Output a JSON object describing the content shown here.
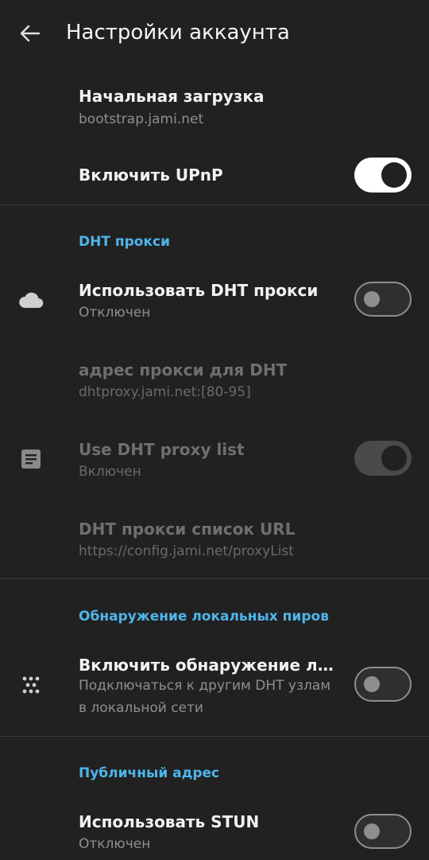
{
  "appbar": {
    "title": "Настройки аккаунта",
    "back_icon": "arrow-back-icon"
  },
  "rows": {
    "bootstrap": {
      "title": "Начальная загрузка",
      "summary": "bootstrap.jami.net"
    },
    "upnp": {
      "title": "Включить UPnP",
      "switch_on": true
    },
    "dht_proxy": {
      "title": "Использовать DHT прокси",
      "summary": "Отключен",
      "icon": "cloud-icon",
      "switch_on": false
    },
    "dht_proxy_address": {
      "title": "адрес прокси для DHT",
      "summary": "dhtproxy.jami.net:[80-95]",
      "enabled": false
    },
    "dht_proxy_list": {
      "title": "Use DHT proxy list",
      "summary": "Включен",
      "icon": "document-icon",
      "switch_on": true,
      "enabled": false
    },
    "dht_proxy_list_url": {
      "title": "DHT прокси список URL",
      "summary": "https://config.jami.net/proxyList",
      "enabled": false
    },
    "local_discovery": {
      "title": "Включить обнаружение лока..",
      "summary": "Подключаться к другим DHT узлам в локальной сети",
      "icon": "peers-dots-icon",
      "switch_on": false
    },
    "stun": {
      "title": "Использовать STUN",
      "summary": "Отключен",
      "switch_on": false
    }
  },
  "sections": {
    "dht_proxy": "DHT прокси",
    "local_peers": "Обнаружение локальных пиров",
    "public_address": "Публичный адрес"
  },
  "colors": {
    "background": "#212121",
    "accent": "#4fb5ea",
    "divider": "#3b3b3b"
  }
}
